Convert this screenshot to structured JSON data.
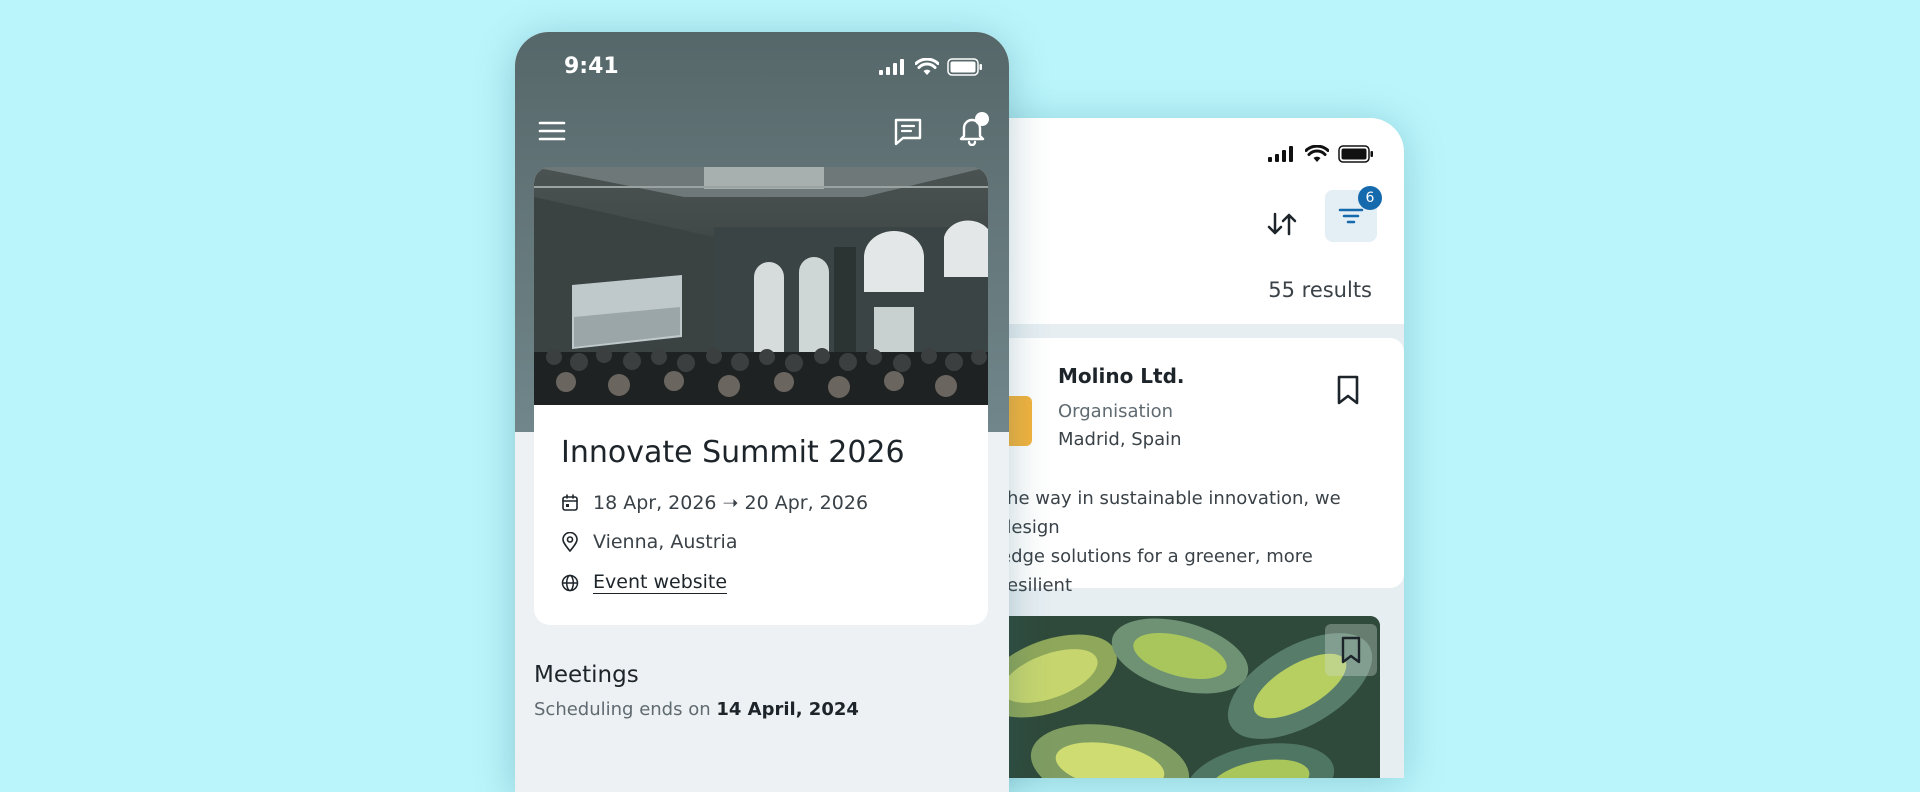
{
  "front_phone": {
    "status_bar": {
      "time": "9:41"
    },
    "header": {
      "menu_icon": "hamburger-icon",
      "chat_icon": "chat-icon",
      "bell_icon": "bell-icon"
    },
    "event": {
      "title": "Innovate Summit 2026",
      "dates": "18 Apr, 2026 ➝ 20 Apr, 2026",
      "location": "Vienna, Austria",
      "website_label": "Event website"
    },
    "meetings": {
      "title": "Meetings",
      "subtitle_prefix": "Scheduling ends on",
      "subtitle_date": "14 April, 2024"
    }
  },
  "back_phone": {
    "filter_count": "6",
    "results": "55 results",
    "card": {
      "name": "Molino Ltd.",
      "type": "Organisation",
      "location": "Madrid, Spain",
      "description_line1": "the way in sustainable innovation, we design",
      "description_line2": "edge solutions for a greener, more resilient"
    }
  },
  "colors": {
    "background": "#baf5fb",
    "accent_badge": "#1569ad",
    "filter_button_bg": "#e3eef5"
  }
}
